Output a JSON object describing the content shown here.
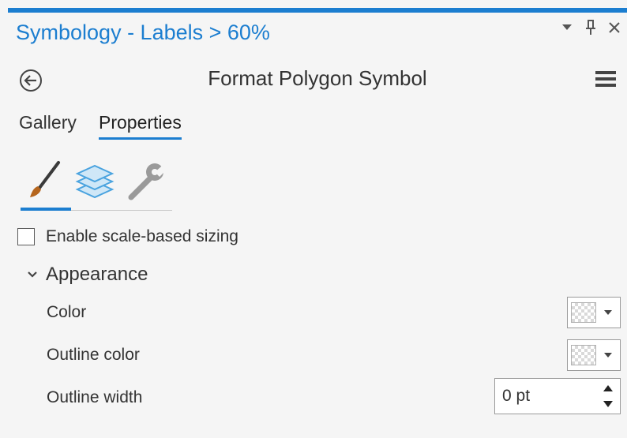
{
  "pane": {
    "title": "Symbology - Labels > 60%",
    "heading": "Format Polygon Symbol"
  },
  "tabs": [
    {
      "label": "Gallery"
    },
    {
      "label": "Properties",
      "active": true
    }
  ],
  "icon_tabs": [
    {
      "icon": "paintbrush-icon",
      "label": "Symbol",
      "active": true
    },
    {
      "icon": "layers-icon",
      "label": "Layers"
    },
    {
      "icon": "wrench-icon",
      "label": "Structure"
    }
  ],
  "scale_sizing": {
    "label": "Enable scale-based sizing",
    "checked": false
  },
  "appearance": {
    "title": "Appearance",
    "expanded": true,
    "color_label": "Color",
    "outline_color_label": "Outline color",
    "outline_width_label": "Outline width",
    "outline_width_value": "0 pt"
  },
  "colors": {
    "accent": "#1c7ed0",
    "text": "#333333",
    "background": "#f5f5f5"
  }
}
